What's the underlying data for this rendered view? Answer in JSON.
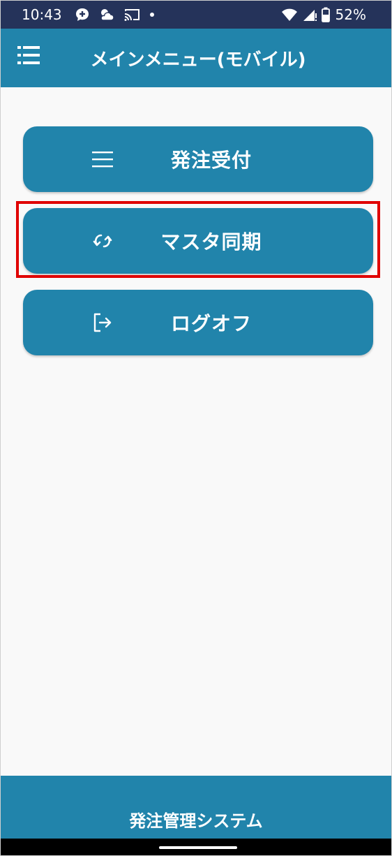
{
  "status_bar": {
    "time": "10:43",
    "battery_percent": "52%",
    "background_color": "#25335a",
    "left_icons": [
      "messenger-plus-icon",
      "weather-icon",
      "cast-icon",
      "dot-icon"
    ],
    "right_icons": [
      "wifi-icon",
      "signal-icon",
      "battery-icon"
    ]
  },
  "app_bar": {
    "title": "メインメニュー(モバイル)",
    "menu_icon": "list-menu-icon",
    "color": "#2184ab"
  },
  "menu": {
    "items": [
      {
        "label": "発注受付",
        "icon": "list-icon"
      },
      {
        "label": "マスタ同期",
        "icon": "sync-icon",
        "highlighted": true
      },
      {
        "label": "ログオフ",
        "icon": "logout-icon"
      }
    ],
    "button_color": "#2184ab",
    "highlight_color": "#e00000"
  },
  "footer": {
    "title": "発注管理システム",
    "color": "#2184ab"
  }
}
